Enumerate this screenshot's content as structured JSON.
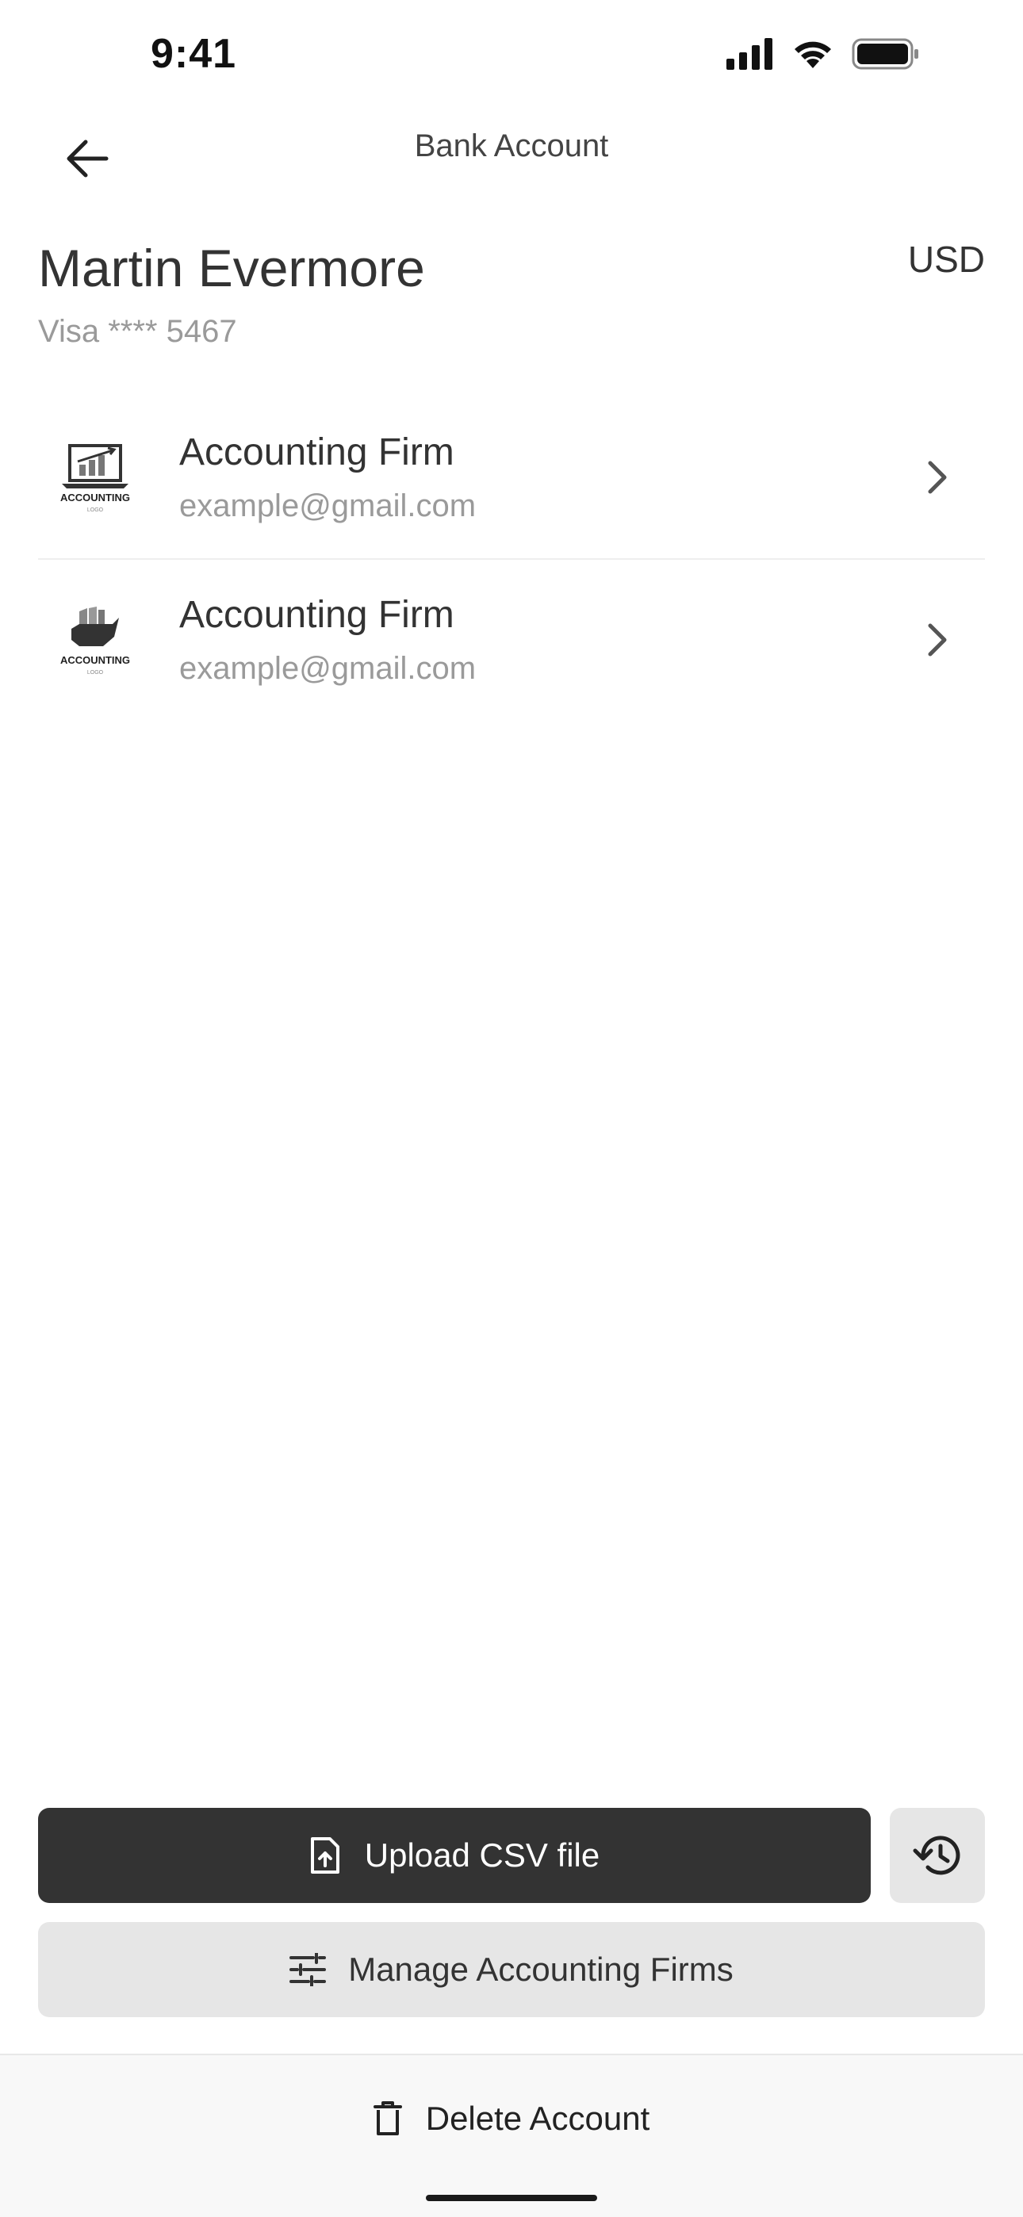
{
  "status_bar": {
    "time": "9:41"
  },
  "nav": {
    "title": "Bank Account"
  },
  "account": {
    "name": "Martin Evermore",
    "card": "Visa **** 5467",
    "currency": "USD"
  },
  "firms": [
    {
      "title": "Accounting Firm",
      "email": "example@gmail.com",
      "logo_text": "ACCOUNTING",
      "logo_sub": "LOGO",
      "logo_icon": "laptop-chart-icon"
    },
    {
      "title": "Accounting Firm",
      "email": "example@gmail.com",
      "logo_text": "ACCOUNTING",
      "logo_sub": "LOGO",
      "logo_icon": "hand-chart-icon"
    }
  ],
  "actions": {
    "upload_label": "Upload CSV file",
    "manage_label": "Manage Accounting Firms",
    "delete_label": "Delete Account"
  },
  "colors": {
    "primary_dark": "#333333",
    "secondary_bg": "#e6e6e6",
    "muted_text": "#9a9a9a"
  }
}
